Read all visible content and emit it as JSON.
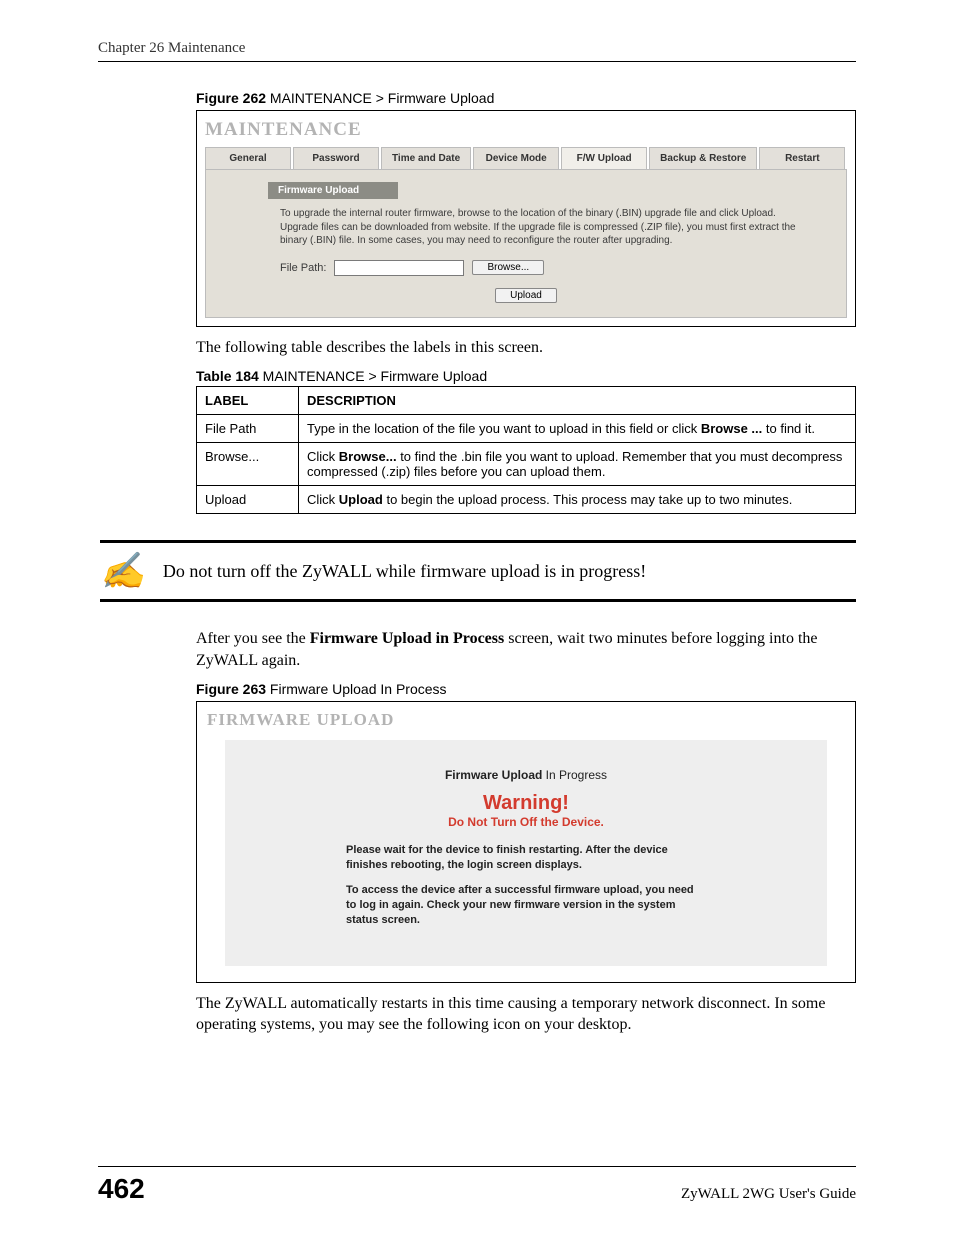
{
  "header": {
    "running": "Chapter 26 Maintenance"
  },
  "figure262": {
    "caption_bold": "Figure 262",
    "caption_rest": "   MAINTENANCE > Firmware Upload",
    "panel_title": "MAINTENANCE",
    "tabs": {
      "general": "General",
      "password": "Password",
      "timedate": "Time and Date",
      "devicemode": "Device Mode",
      "fwupload": "F/W Upload",
      "backup": "Backup & Restore",
      "restart": "Restart"
    },
    "band": "Firmware Upload",
    "instructions": "To upgrade the internal router firmware, browse to the location of the binary (.BIN) upgrade file and click Upload. Upgrade files can be downloaded from website. If the upgrade file is compressed (.ZIP file), you must first extract the binary (.BIN) file. In some cases, you may need to reconfigure the router after upgrading.",
    "filepath_label": "File Path:",
    "browse_btn": "Browse...",
    "upload_btn": "Upload"
  },
  "para1": "The following table describes the labels in this screen.",
  "table184": {
    "caption_bold": "Table 184",
    "caption_rest": "   MAINTENANCE > Firmware Upload",
    "head_label": "LABEL",
    "head_desc": "DESCRIPTION",
    "rows": [
      {
        "label": "File Path",
        "desc_pre": "Type in the location of the file you want to upload in this field or click ",
        "desc_bold": "Browse ...",
        "desc_post": " to find it."
      },
      {
        "label": "Browse...",
        "desc_pre": "Click ",
        "desc_bold": "Browse...",
        "desc_post": " to find the .bin file you want to upload. Remember that you must decompress compressed (.zip) files before you can upload them."
      },
      {
        "label": "Upload",
        "desc_pre": "Click ",
        "desc_bold": "Upload",
        "desc_post": " to begin the upload process. This process may take up to two minutes."
      }
    ]
  },
  "note": {
    "icon": "✍",
    "text": "Do not turn off the ZyWALL while firmware upload is in progress!"
  },
  "para2_pre": "After you see the ",
  "para2_bold": "Firmware Upload in Process",
  "para2_post": " screen, wait two minutes before logging into the ZyWALL again.",
  "figure263": {
    "caption_bold": "Figure 263",
    "caption_rest": "   Firmware Upload In Process",
    "panel_title": "FIRMWARE UPLOAD",
    "line1_bold": "Firmware Upload",
    "line1_rest": " In Progress",
    "warn": "Warning!",
    "warn2": "Do Not Turn Off the Device.",
    "p1": "Please wait for the device to finish restarting. After the device finishes rebooting, the login screen displays.",
    "p2": "To access the device after a successful firmware upload, you need to log in again. Check your new firmware version in the system status screen."
  },
  "para3": "The ZyWALL automatically restarts in this time causing a temporary network disconnect. In some operating systems, you may see the following icon on your desktop.",
  "footer": {
    "page": "462",
    "guide": "ZyWALL 2WG User's Guide"
  }
}
